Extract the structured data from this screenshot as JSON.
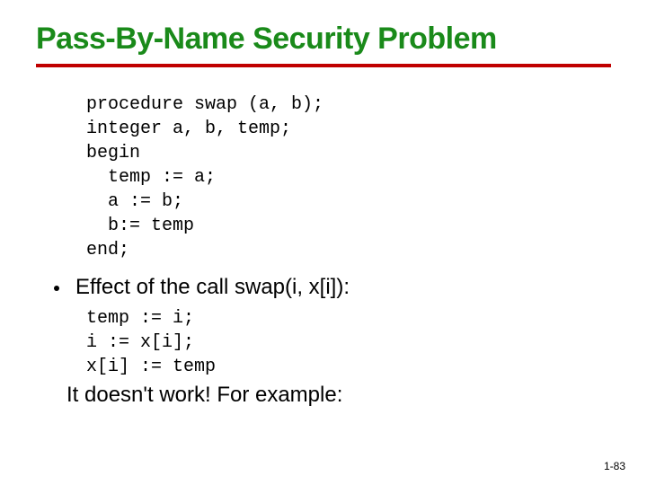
{
  "title": "Pass-By-Name Security Problem",
  "code1": "procedure swap (a, b);\ninteger a, b, temp;\nbegin\n  temp := a;\n  a := b;\n  b:= temp\nend;",
  "bullet": "Effect of the call swap(i, x[i]):",
  "code2": "temp := i;\ni := x[i];\nx[i] := temp",
  "conclude": "It doesn't work! For example:",
  "pagenum": "1-83"
}
